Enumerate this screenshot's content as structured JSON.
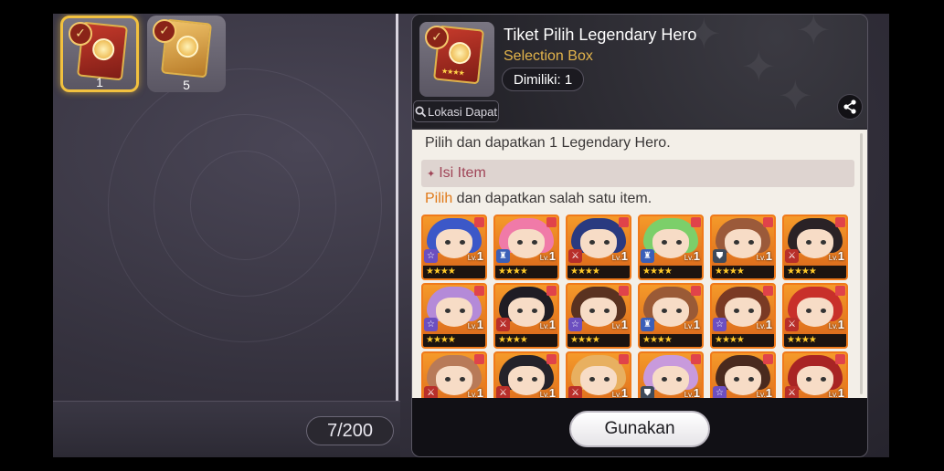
{
  "inventory": {
    "slots": [
      {
        "count": "1",
        "icon": "red-legendary-ticket-icon",
        "selected": true
      },
      {
        "count": "5",
        "icon": "gold-ticket-icon",
        "selected": false
      }
    ],
    "capacity": "7/200"
  },
  "detail": {
    "title": "Tiket Pilih Legendary Hero",
    "type": "Selection Box",
    "owned": "Dimiliki: 1",
    "source_button": "Lokasi Dapat",
    "description": "Pilih dan dapatkan 1 Legendary Hero.",
    "section_header": "Isi Item",
    "instruction_highlight": "Pilih",
    "instruction_rest": " dan dapatkan salah satu item.",
    "use_button": "Gunakan"
  },
  "heroes": [
    {
      "level": "1",
      "stars": "★★★★",
      "class": "magic",
      "hair": "#3c58c8"
    },
    {
      "level": "1",
      "stars": "★★★★",
      "class": "tank",
      "hair": "#f07aa8"
    },
    {
      "level": "1",
      "stars": "★★★★",
      "class": "warrior",
      "hair": "#2a3a80"
    },
    {
      "level": "1",
      "stars": "★★★★",
      "class": "tank",
      "hair": "#7ccf6a"
    },
    {
      "level": "1",
      "stars": "★★★★",
      "class": "ranger",
      "hair": "#9b5a3a"
    },
    {
      "level": "1",
      "stars": "★★★★",
      "class": "warrior",
      "hair": "#2a2226"
    },
    {
      "level": "1",
      "stars": "★★★★",
      "class": "magic",
      "hair": "#b48ad8"
    },
    {
      "level": "1",
      "stars": "★★★★",
      "class": "warrior",
      "hair": "#1f1c24"
    },
    {
      "level": "1",
      "stars": "★★★★",
      "class": "magic",
      "hair": "#5a3220"
    },
    {
      "level": "1",
      "stars": "★★★★",
      "class": "tank",
      "hair": "#9a5a36"
    },
    {
      "level": "1",
      "stars": "★★★★",
      "class": "magic",
      "hair": "#7a3a24"
    },
    {
      "level": "1",
      "stars": "★★★★",
      "class": "warrior",
      "hair": "#c8302a"
    },
    {
      "level": "1",
      "stars": "★★★★",
      "class": "warrior",
      "hair": "#b87a58"
    },
    {
      "level": "1",
      "stars": "★★★★",
      "class": "warrior",
      "hair": "#24222a"
    },
    {
      "level": "1",
      "stars": "★★★★",
      "class": "warrior",
      "hair": "#e8b060"
    },
    {
      "level": "1",
      "stars": "★★★★",
      "class": "ranger",
      "hair": "#c89adc"
    },
    {
      "level": "1",
      "stars": "★★★★",
      "class": "magic",
      "hair": "#4a2a1e"
    },
    {
      "level": "1",
      "stars": "★★★★",
      "class": "warrior",
      "hair": "#a82424"
    }
  ],
  "icons": {
    "check": "check-icon",
    "search": "search-icon",
    "share": "share-icon",
    "diamond": "diamond-icon"
  },
  "colors": {
    "selected_border": "#f2c13f",
    "item_type": "#e3b44b",
    "section_text": "#a04558",
    "highlight": "#e07a1a",
    "hero_frame": "#f07a1a"
  }
}
